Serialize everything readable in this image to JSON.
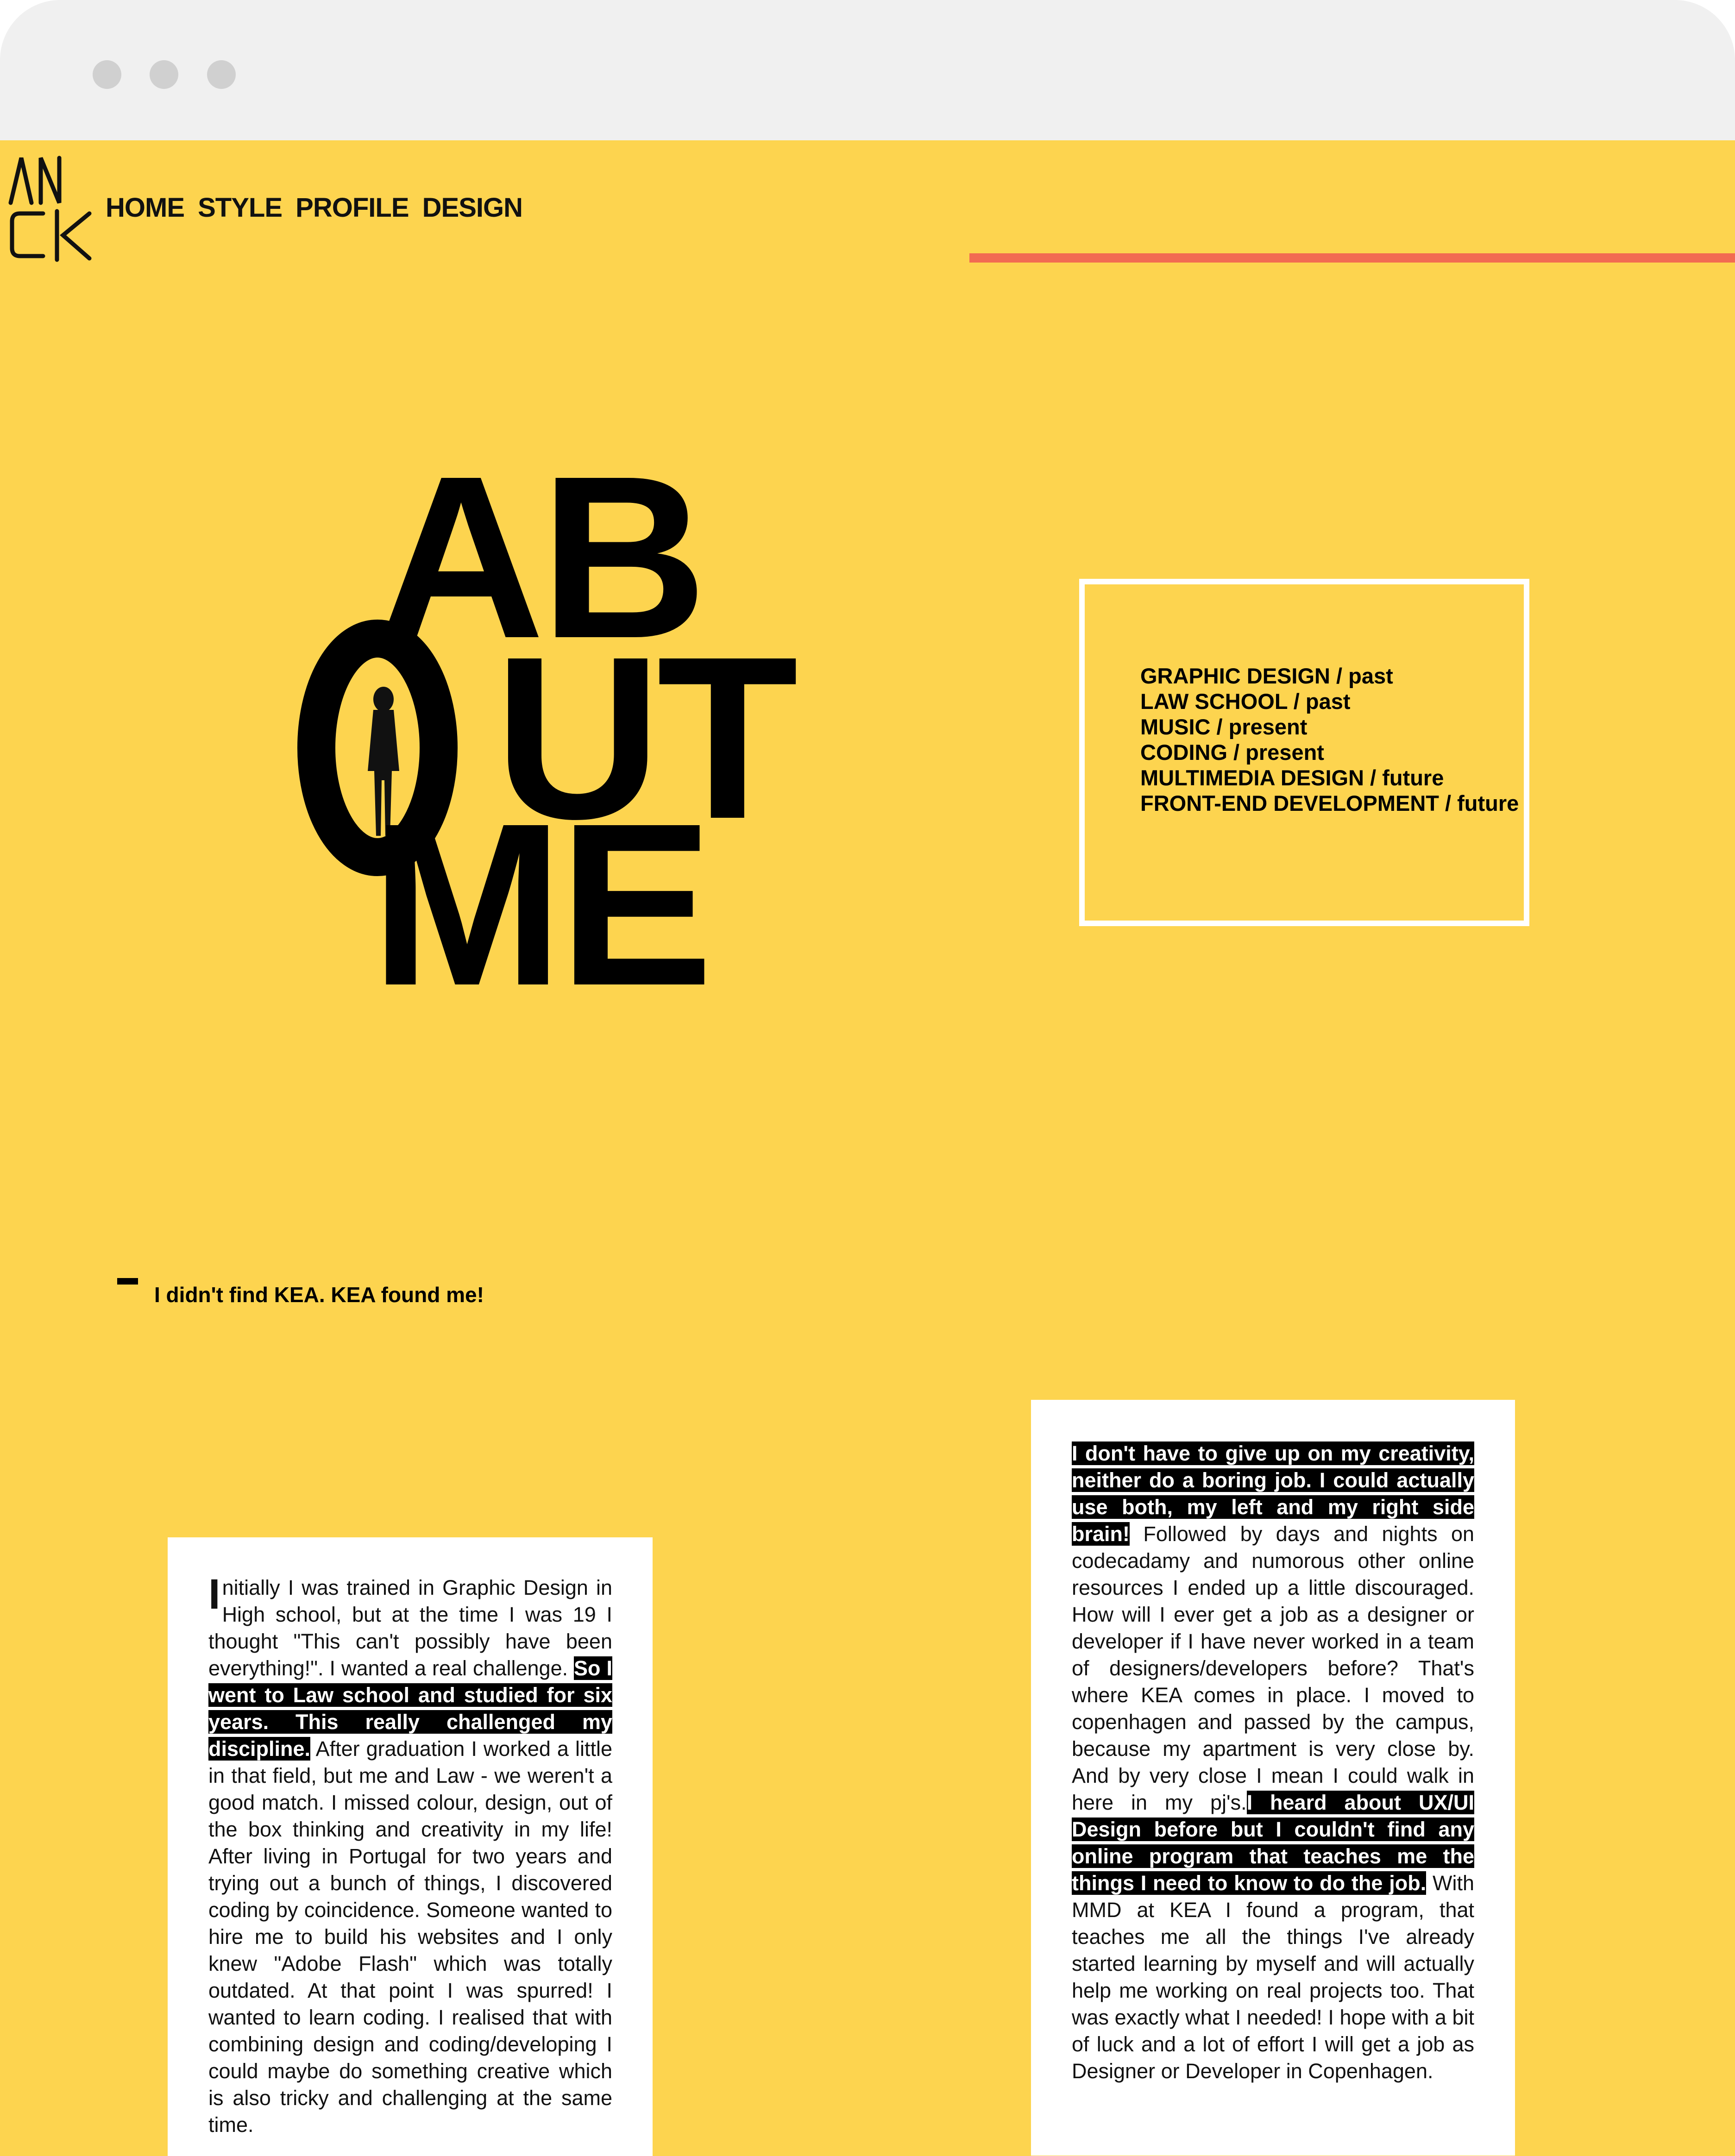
{
  "nav": {
    "logo_text": "AN CK",
    "items": [
      "HOME",
      "STYLE",
      "PROFILE",
      "DESIGN"
    ]
  },
  "hero": {
    "line1": "AB",
    "letter_o": "O",
    "line2_rest": "UT",
    "line3": "ME"
  },
  "skills": [
    "GRAPHIC DESIGN / past",
    "LAW SCHOOL / past",
    "MUSIC / present",
    "CODING / present",
    "MULTIMEDIA DESIGN / future",
    "FRONT-END DEVELOPMENT / future"
  ],
  "quote": "I didn't find KEA. KEA found me!",
  "story_left": {
    "dropcap": "I",
    "p1": "nitially I was trained in Graphic Design in High school, but at the time I was 19 I thought \"This can't possibly have been everything!\". I wanted a real challenge. ",
    "h1": "So I went to Law school and studied for six years. This really challenged my discipline.",
    "p2": " After graduation I worked a little in that field, but me and Law - we weren't a good match. I missed colour, design, out of the box thinking and creativity in my life! After living in Portugal for two years and trying out a bunch of things, I discovered coding by coincidence. Someone wanted to hire me to build his websites and I only knew \"Adobe Flash\" which was totally outdated. At that point I was spurred! I wanted to learn coding. I realised that with combining design and coding/developing I could maybe do something creative which is also tricky and challenging at the same time."
  },
  "story_right": {
    "h1": "I don't have to give up on my creativity, neither do a boring job. I could actually use both, my left and my right side brain!",
    "p1": " Followed by days and nights on codecadamy and numorous other online resources I ended up a little discouraged. How will I ever get a job as a designer or developer if I have never worked in a team of designers/developers before? That's where KEA comes in place. I moved to copenhagen and passed by the campus, because my apartment is very close by. And by very close I mean I could walk in here in my pj's.",
    "h2": "I heard about UX/UI Design before but I couldn't find any online program that teaches me the things I need to know to do the job.",
    "p2": " With MMD at KEA I found a program, that teaches me all the things I've already started learning by myself and will actually help me working on real projects too. That was exactly what I needed! I hope with a bit of luck and a lot of effort I will get a job as Designer or Developer in Copenhagen."
  },
  "colors": {
    "background": "#fdd44f",
    "accent_line": "#f26b52",
    "text": "#000000"
  }
}
